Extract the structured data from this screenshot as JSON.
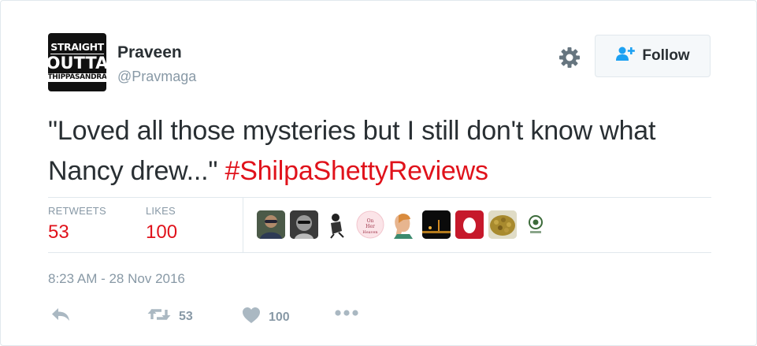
{
  "user": {
    "avatar_text": [
      "STRAIGHT",
      "OUTTA",
      "THIPPASANDRA"
    ],
    "name": "Praveen",
    "handle": "@Pravmaga"
  },
  "header": {
    "settings_icon": "gear-icon",
    "follow_label": "Follow",
    "follow_icon": "add-user-icon"
  },
  "tweet": {
    "text": "\"Loved all those mysteries but I still don't know what Nancy drew...\" ",
    "hashtag": "#ShilpaShettyReviews"
  },
  "stats": {
    "retweets_label": "RETWEETS",
    "retweets_count": "53",
    "likes_label": "LIKES",
    "likes_count": "100"
  },
  "liker_avatars": [
    "avatar-person-glasses",
    "avatar-person-bw",
    "avatar-sketch-figure",
    "avatar-pink-badge",
    "avatar-cartoon-profile",
    "avatar-dark-lights",
    "avatar-egg-red",
    "avatar-food",
    "avatar-green-logo"
  ],
  "timestamp": "8:23 AM - 28 Nov 2016",
  "actions": {
    "reply_icon": "reply-icon",
    "retweet_icon": "retweet-icon",
    "retweet_count": "53",
    "like_icon": "heart-icon",
    "like_count": "100",
    "more_icon": "more-dots-icon"
  },
  "colors": {
    "accent": "#e0121b",
    "text": "#292f33",
    "muted": "#8899a6",
    "follow_icon": "#1da1f2"
  }
}
